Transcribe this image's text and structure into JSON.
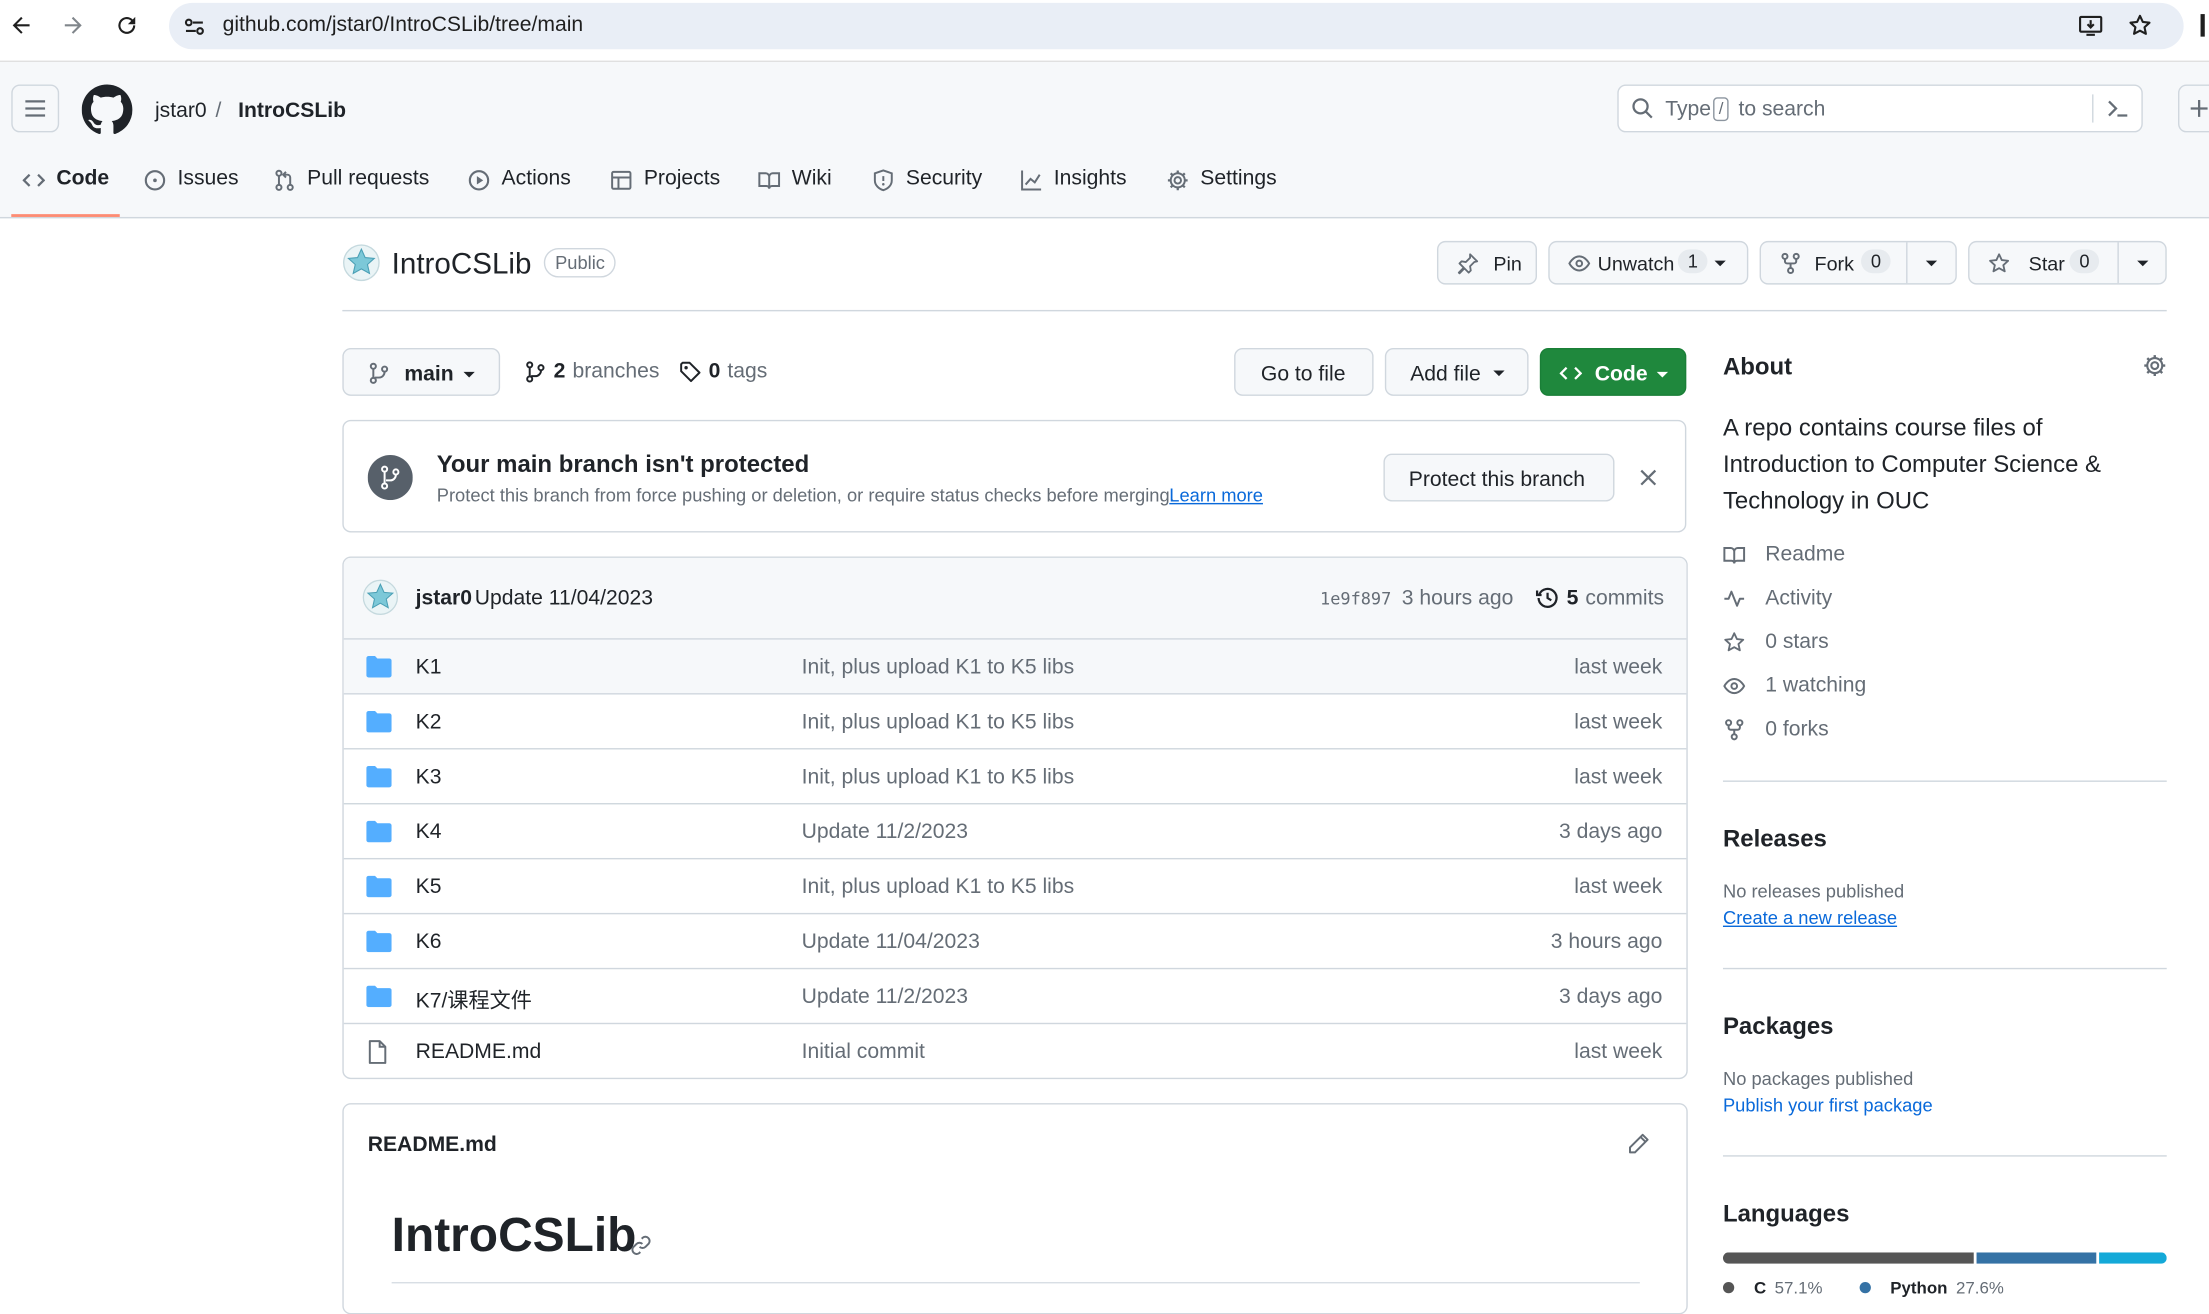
{
  "browser": {
    "url": "github.com/jstar0/IntroCSLib/tree/main"
  },
  "header": {
    "owner": "jstar0",
    "separator": "/",
    "repo": "IntroCSLib",
    "search_placeholder_pre": "Type",
    "search_key": "/",
    "search_placeholder_post": "to search"
  },
  "nav": {
    "tabs": [
      {
        "label": "Code",
        "icon": "code-icon"
      },
      {
        "label": "Issues",
        "icon": "issue-icon"
      },
      {
        "label": "Pull requests",
        "icon": "pull-request-icon"
      },
      {
        "label": "Actions",
        "icon": "play-icon"
      },
      {
        "label": "Projects",
        "icon": "table-icon"
      },
      {
        "label": "Wiki",
        "icon": "book-icon"
      },
      {
        "label": "Security",
        "icon": "shield-icon"
      },
      {
        "label": "Insights",
        "icon": "graph-icon"
      },
      {
        "label": "Settings",
        "icon": "gear-icon"
      }
    ]
  },
  "repo": {
    "name": "IntroCSLib",
    "visibility": "Public",
    "pin_label": "Pin",
    "unwatch_label": "Unwatch",
    "watch_count": "1",
    "fork_label": "Fork",
    "fork_count": "0",
    "star_label": "Star",
    "star_count": "0"
  },
  "toolbar": {
    "branch": "main",
    "branches_count": "2",
    "branches_label": "branches",
    "tags_count": "0",
    "tags_label": "tags",
    "go_to_file": "Go to file",
    "add_file": "Add file",
    "code": "Code"
  },
  "banner": {
    "title": "Your main branch isn't protected",
    "text": "Protect this branch from force pushing or deletion, or require status checks before merging.",
    "link": "Learn more",
    "button": "Protect this branch"
  },
  "commit": {
    "author": "jstar0",
    "message": "Update 11/04/2023",
    "hash": "1e9f897",
    "time": "3 hours ago",
    "commits_count": "5",
    "commits_label": "commits"
  },
  "files": [
    {
      "name": "K1",
      "type": "folder",
      "message": "Init, plus upload K1 to K5 libs",
      "age": "last week"
    },
    {
      "name": "K2",
      "type": "folder",
      "message": "Init, plus upload K1 to K5 libs",
      "age": "last week"
    },
    {
      "name": "K3",
      "type": "folder",
      "message": "Init, plus upload K1 to K5 libs",
      "age": "last week"
    },
    {
      "name": "K4",
      "type": "folder",
      "message": "Update 11/2/2023",
      "age": "3 days ago"
    },
    {
      "name": "K5",
      "type": "folder",
      "message": "Init, plus upload K1 to K5 libs",
      "age": "last week"
    },
    {
      "name": "K6",
      "type": "folder",
      "message": "Update 11/04/2023",
      "age": "3 hours ago"
    },
    {
      "name": "K7/课程文件",
      "type": "folder",
      "message": "Update 11/2/2023",
      "age": "3 days ago"
    },
    {
      "name": "README.md",
      "type": "file",
      "message": "Initial commit",
      "age": "last week"
    }
  ],
  "readme": {
    "filename": "README.md",
    "heading": "IntroCSLib"
  },
  "about": {
    "title": "About",
    "description": "A repo contains course files of Introduction to Computer Science & Technology in OUC",
    "readme": "Readme",
    "activity": "Activity",
    "stars": "0 stars",
    "watching": "1 watching",
    "forks": "0 forks"
  },
  "releases": {
    "title": "Releases",
    "text": "No releases published",
    "link": "Create a new release"
  },
  "packages": {
    "title": "Packages",
    "text": "No packages published",
    "link": "Publish your first package"
  },
  "languages": {
    "title": "Languages",
    "items": [
      {
        "name": "C",
        "percent": "57.1%",
        "value": 57.1,
        "color": "#555555"
      },
      {
        "name": "Python",
        "percent": "27.6%",
        "value": 27.6,
        "color": "#3572A5"
      },
      {
        "name": "",
        "percent": "",
        "value": 15.3,
        "color": "#14a9d8"
      }
    ]
  },
  "colors": {
    "accent": "#0969da",
    "green": "#1f883d",
    "folder": "#54aeff",
    "underline": "#fd8c73"
  }
}
